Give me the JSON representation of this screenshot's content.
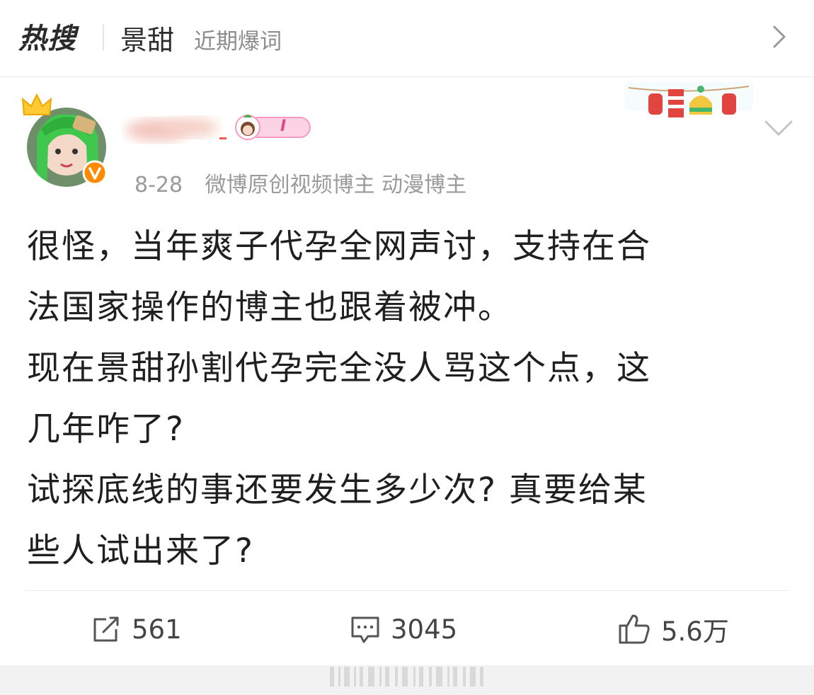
{
  "header": {
    "logo_text": "热搜",
    "topic": "景甜",
    "subtitle": "近期爆词"
  },
  "post": {
    "date": "8-28",
    "source": "微博原创视频博主 动漫博主",
    "member_level": "I",
    "lines": [
      "很怪，当年爽子代孕全网声讨，支持在合",
      "法国家操作的博主也跟着被冲。",
      "现在景甜孙割代孕完全没人骂这个点，这",
      "几年咋了?",
      "试探底线的事还要发生多少次? 真要给某",
      "些人试出来了?"
    ]
  },
  "actions": {
    "repost_count": "561",
    "comment_count": "3045",
    "like_count": "5.6万"
  },
  "colors": {
    "brand_orange": "#ff8200",
    "text_primary": "#1f1f1f",
    "text_meta": "#9a9a9a",
    "badge_pink": "#f7a1c4"
  },
  "icons": [
    "crown-icon",
    "verified-icon",
    "chevron-right-icon",
    "chevron-down-icon",
    "repost-icon",
    "comment-icon",
    "like-icon"
  ]
}
